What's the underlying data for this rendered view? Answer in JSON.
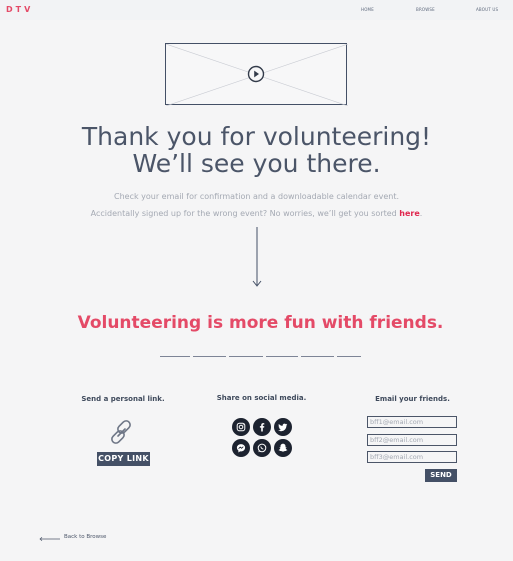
{
  "header": {
    "logo": "DTV",
    "nav": [
      "HOME",
      "BROWSE",
      "ABOUT US"
    ]
  },
  "video": {
    "play_icon": "play-circle-icon"
  },
  "main": {
    "title_line1": "Thank you for volunteering!",
    "title_line2": "We’ll see you there.",
    "sub_line1": "Check your email for confirmation and a downloadable calendar event.",
    "sub_line2_text": "Accidentally signed up for the wrong event? No worries, we’ll get you sorted ",
    "sub_line2_link": "here",
    "sub_line2_end": "."
  },
  "friends": {
    "heading": "Volunteering is more fun with friends."
  },
  "share_link": {
    "heading": "Send a personal link.",
    "icon": "link-icon",
    "button": "COPY LINK"
  },
  "social": {
    "heading": "Share on social media.",
    "icons": [
      "instagram-icon",
      "facebook-icon",
      "twitter-icon",
      "messenger-icon",
      "whatsapp-icon",
      "snapchat-icon"
    ]
  },
  "email": {
    "heading": "Email your friends.",
    "placeholders": [
      "bff1@email.com",
      "bff2@email.com",
      "bff3@email.com"
    ],
    "send": "SEND"
  },
  "footer": {
    "back": "Back to Browse"
  },
  "colors": {
    "accent": "#e44a67",
    "dark": "#445066",
    "link": "#e0284f"
  }
}
